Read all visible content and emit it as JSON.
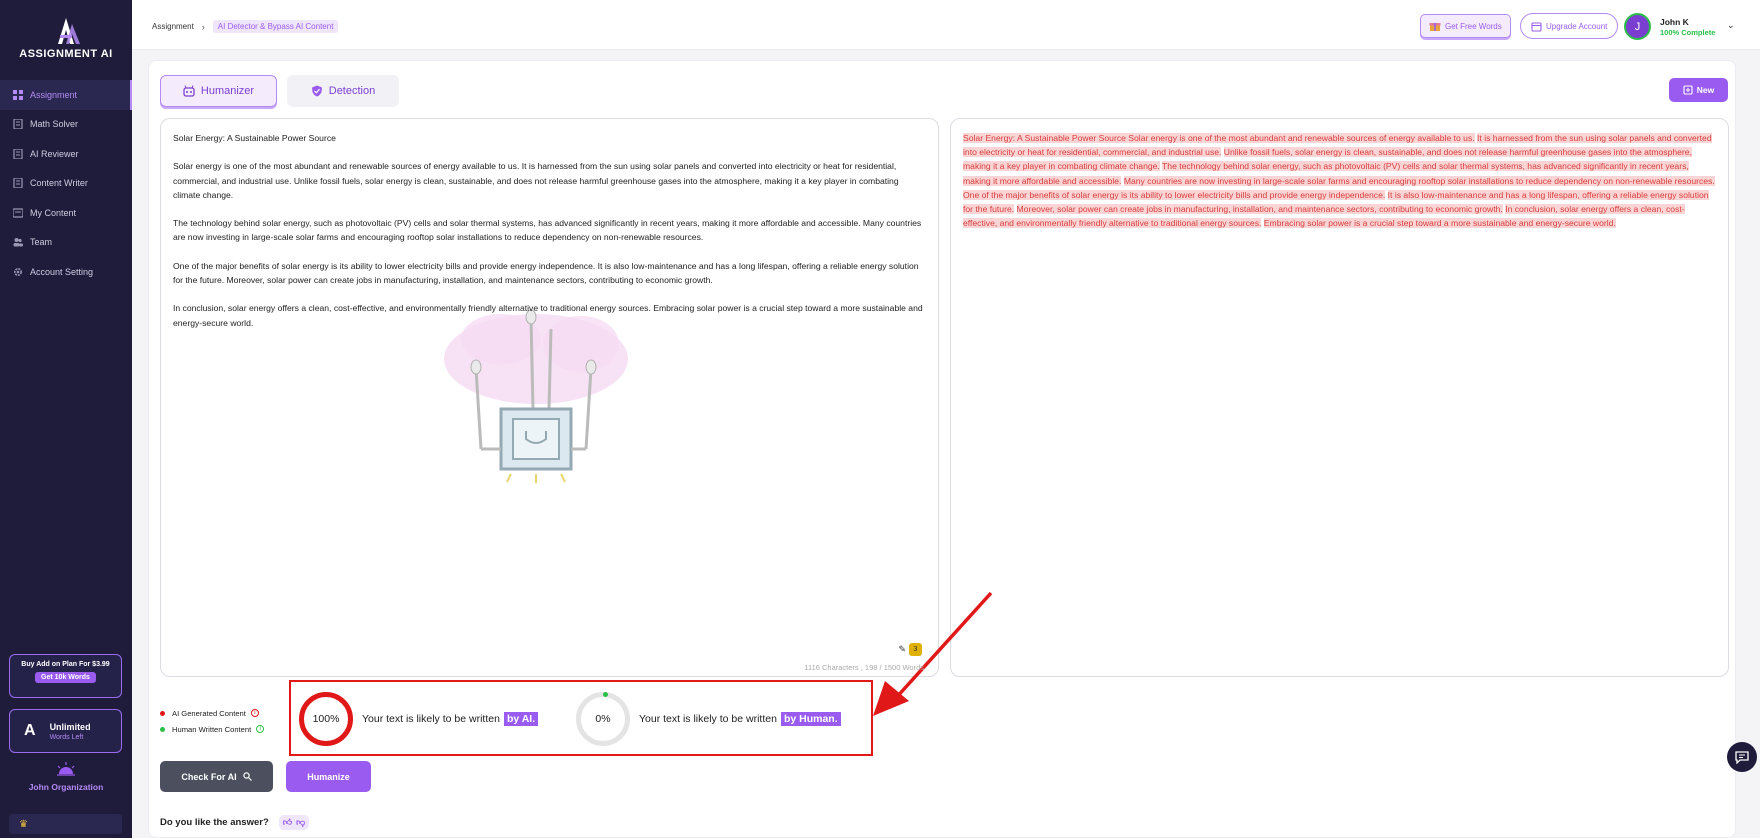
{
  "app": {
    "logo_text": "ASSIGNMENT AI"
  },
  "sidebar": {
    "items": [
      {
        "label": "Assignment",
        "icon": "grid-icon",
        "active": true
      },
      {
        "label": "Math Solver",
        "icon": "document-icon",
        "active": false
      },
      {
        "label": "AI Reviewer",
        "icon": "document-icon",
        "active": false
      },
      {
        "label": "Content Writer",
        "icon": "document-icon",
        "active": false
      },
      {
        "label": "My Content",
        "icon": "folder-icon",
        "active": false
      },
      {
        "label": "Team",
        "icon": "team-icon",
        "active": false
      },
      {
        "label": "Account Setting",
        "icon": "gear-icon",
        "active": false
      }
    ],
    "addon": {
      "title": "Buy Add on Plan For $3.99",
      "button": "Get 10k Words"
    },
    "plan": {
      "letter": "A",
      "title": "Unlimited",
      "subtitle": "Words Left"
    },
    "organization": "John Organization"
  },
  "header": {
    "breadcrumb": [
      "Assignment",
      "AI Detector & Bypass AI Content"
    ],
    "free_words": "Get Free Words",
    "upgrade": "Upgrade Account",
    "user": {
      "initial": "J",
      "name": "John K",
      "progress": "100% Complete"
    }
  },
  "tabs": {
    "humanizer": "Humanizer",
    "detection": "Detection"
  },
  "new_button": "New",
  "editor": {
    "paragraphs": [
      "Solar Energy: A Sustainable Power Source",
      "Solar energy is one of the most abundant and renewable sources of energy available to us. It is harnessed from the sun using solar panels and converted into electricity or heat for residential, commercial, and industrial use. Unlike fossil fuels, solar energy is clean, sustainable, and does not release harmful greenhouse gases into the atmosphere, making it a key player in combating climate change.",
      "The technology behind solar energy, such as photovoltaic (PV) cells and solar thermal systems, has advanced significantly in recent years, making it more affordable and accessible. Many countries are now investing in large-scale solar farms and encouraging rooftop solar installations to reduce dependency on non-renewable resources.",
      "One of the major benefits of solar energy is its ability to lower electricity bills and provide energy independence. It is also low-maintenance and has a long lifespan, offering a reliable energy solution for the future. Moreover, solar power can create jobs in manufacturing, installation, and maintenance sectors, contributing to economic growth.",
      "In conclusion, solar energy offers a clean, cost-effective, and environmentally friendly alternative to traditional energy sources. Embracing solar power is a crucial step toward a more sustainable and energy-secure world."
    ],
    "counter": "1116 Characters , 198 / 1500 Words",
    "badge": "3"
  },
  "result": {
    "segments": [
      "Solar Energy: A Sustainable Power Source Solar energy is one of the most abundant and renewable sources of energy available to us.",
      "It is harnessed from the sun using solar panels and converted into electricity or heat for residential, commercial, and industrial use.",
      "Unlike fossil fuels, solar energy is clean, sustainable, and does not release harmful greenhouse gases into the atmosphere, making it a key player in combating climate change.",
      "The technology behind solar energy, such as photovoltaic (PV) cells and solar thermal systems, has advanced significantly in recent years, making it more affordable and accessible.",
      "Many countries are now investing in large-scale solar farms and encouraging rooftop solar installations to reduce dependency on non-renewable resources.",
      "One of the major benefits of solar energy is its ability to lower electricity bills and provide energy independence.",
      "It is also low-maintenance and has a long lifespan, offering a reliable energy solution for the future.",
      "Moreover, solar power can create jobs in manufacturing, installation, and maintenance sectors, contributing to economic growth.",
      "In conclusion, solar energy offers a clean, cost-effective, and environmentally friendly alternative to traditional energy sources.",
      "Embracing solar power is a crucial step toward a more sustainable and energy-secure world."
    ]
  },
  "legend": {
    "ai": "AI Generated Content",
    "human": "Human Written Content"
  },
  "scores": {
    "ai_value": "100%",
    "ai_text": "Your text is likely to be written",
    "ai_tag": "by AI.",
    "human_value": "0%",
    "human_text": "Your text is likely to be written",
    "human_tag": "by Human."
  },
  "buttons": {
    "check": "Check For AI",
    "humanize": "Humanize"
  },
  "feedback": {
    "question": "Do you like the answer?"
  },
  "colors": {
    "accent": "#9a5cf0",
    "sidebar_bg": "#1e1c3a",
    "ai_red": "#e01818",
    "human_green": "#2bbf4a"
  }
}
